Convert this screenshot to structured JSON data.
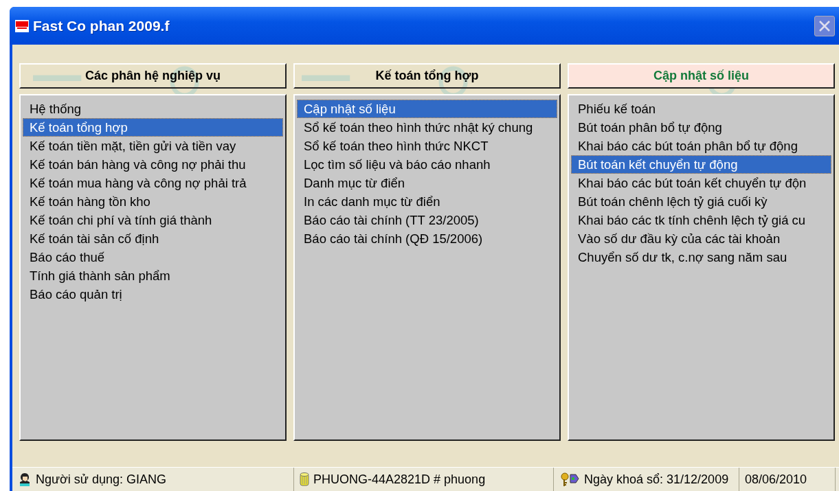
{
  "window": {
    "title": "Fast Co phan 2009.f"
  },
  "columns": [
    {
      "header": "Các phân hệ nghiệp vụ",
      "selected": false,
      "items": [
        {
          "label": "Hệ thống",
          "selected": false
        },
        {
          "label": "Kế toán tổng hợp",
          "selected": true
        },
        {
          "label": "Kế toán tiền mặt, tiền gửi và tiền vay",
          "selected": false
        },
        {
          "label": "Kế toán bán hàng và công nợ phải thu",
          "selected": false
        },
        {
          "label": "Kế toán mua hàng và công nợ phải trả",
          "selected": false
        },
        {
          "label": "Kế toán hàng tồn kho",
          "selected": false
        },
        {
          "label": "Kế toán chi phí và tính giá thành",
          "selected": false
        },
        {
          "label": "Kế toán tài sản cố định",
          "selected": false
        },
        {
          "label": "Báo cáo thuế",
          "selected": false
        },
        {
          "label": "Tính giá thành sản phẩm",
          "selected": false
        },
        {
          "label": "Báo cáo quản trị",
          "selected": false
        }
      ]
    },
    {
      "header": "Kế toán tổng hợp",
      "selected": false,
      "items": [
        {
          "label": "Cập nhật số liệu",
          "selected": true
        },
        {
          "label": "Sổ kế toán theo hình thức nhật ký chung",
          "selected": false
        },
        {
          "label": "Sổ kế toán theo hình thức NKCT",
          "selected": false
        },
        {
          "label": "Lọc tìm số liệu và báo cáo nhanh",
          "selected": false
        },
        {
          "label": "Danh mục từ điển",
          "selected": false
        },
        {
          "label": "In các danh mục từ điển",
          "selected": false
        },
        {
          "label": "Báo cáo tài chính (TT 23/2005)",
          "selected": false
        },
        {
          "label": "Báo cáo tài chính (QĐ 15/2006)",
          "selected": false
        }
      ]
    },
    {
      "header": "Cập nhật số liệu",
      "selected": true,
      "items": [
        {
          "label": "Phiếu kế toán",
          "selected": false
        },
        {
          "label": "Bút toán phân bổ tự động",
          "selected": false
        },
        {
          "label": "Khai báo các bút toán phân bổ tự động",
          "selected": false
        },
        {
          "label": "Bút toán kết chuyển tự động",
          "selected": true
        },
        {
          "label": "Khai báo các bút toán kết chuyển tự độn",
          "selected": false
        },
        {
          "label": "Bút toán chênh lệch tỷ giá cuối kỳ",
          "selected": false
        },
        {
          "label": "Khai báo các tk tính chênh lệch tỷ giá cu",
          "selected": false
        },
        {
          "label": "Vào số dư đầu kỳ của các tài khoản",
          "selected": false
        },
        {
          "label": "Chuyển số dư tk, c.nợ sang năm sau",
          "selected": false
        }
      ]
    }
  ],
  "status_bar": [
    {
      "kind": "user",
      "text": "Người sử dụng: GIANG"
    },
    {
      "kind": "database",
      "text": "PHUONG-44A2821D # phuong"
    },
    {
      "kind": "lock",
      "text": "Ngày khoá sổ: 31/12/2009"
    },
    {
      "kind": "plain",
      "text": "08/06/2010"
    }
  ]
}
